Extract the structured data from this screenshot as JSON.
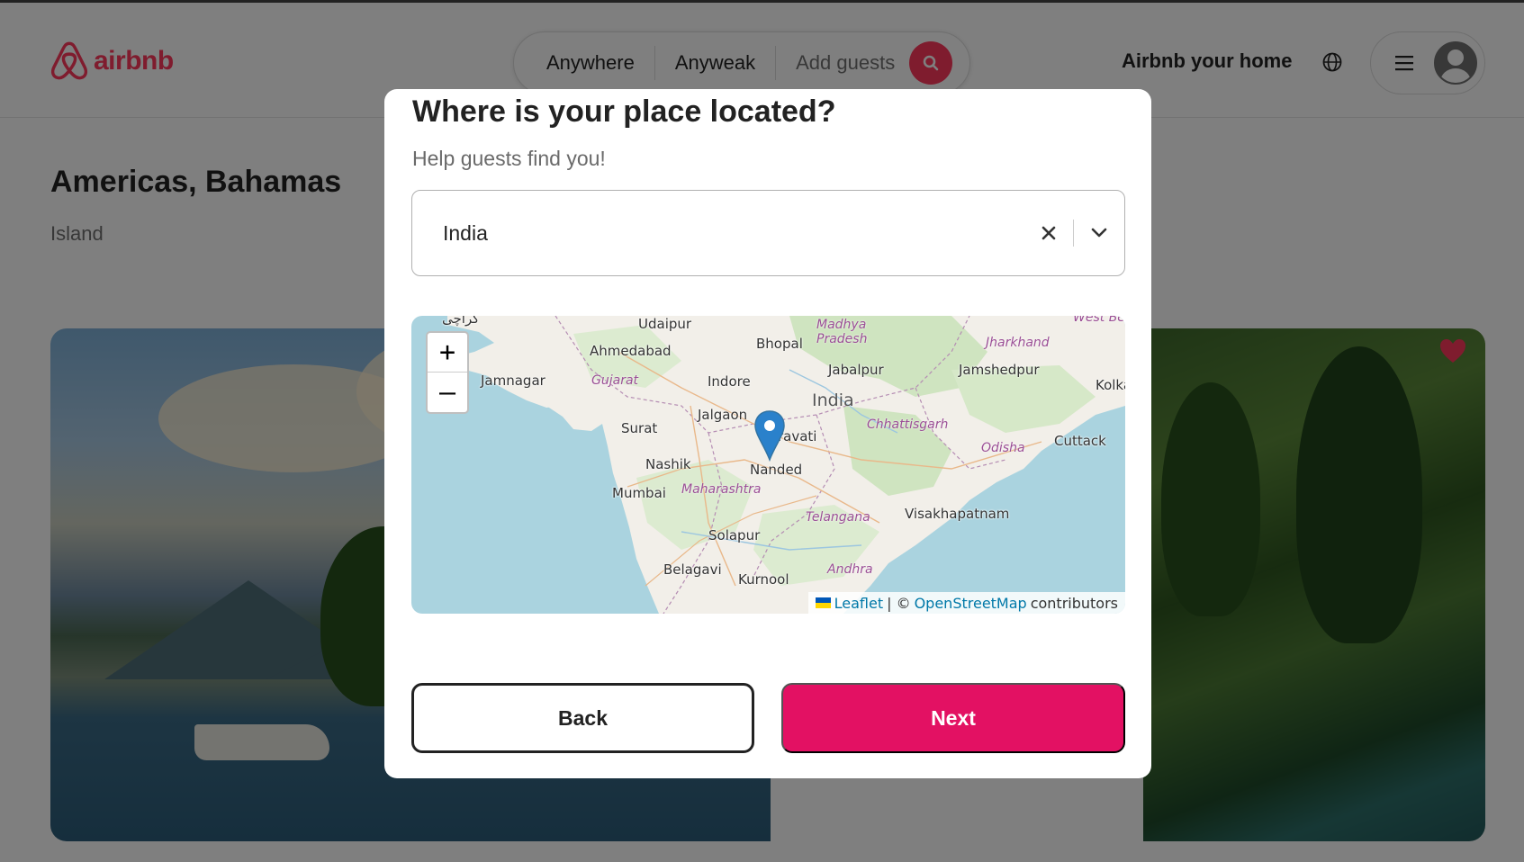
{
  "header": {
    "logo_text": "airbnb",
    "search": {
      "location": "Anywhere",
      "dates": "Anyweak",
      "guests": "Add guests"
    },
    "host_link": "Airbnb your home"
  },
  "listing": {
    "title": "Americas, Bahamas",
    "type": "Island"
  },
  "modal": {
    "title": "Where is your place located?",
    "subtitle": "Help guests find you!",
    "country_select": {
      "value": "India"
    },
    "map": {
      "zoom_in": "+",
      "zoom_out": "–",
      "country_label": "India",
      "cities": [
        "Udaipur",
        "Bhopal",
        "Ahmedabad",
        "Jabalpur",
        "Jamshedpur",
        "Jamnagar",
        "Indore",
        "Kolka",
        "Jalgaon",
        "Surat",
        "Cuttack",
        "ravati",
        "Nashik",
        "Nanded",
        "Mumbai",
        "Visakhapatnam",
        "Solapur",
        "Belagavi",
        "Kurnool"
      ],
      "states": [
        "Madhya",
        "Pradesh",
        "Jharkhand",
        "Gujarat",
        "Chhattisgarh",
        "Odisha",
        "Maharashtra",
        "Telangana",
        "Andhra",
        "West Be"
      ],
      "top_left_label": "کراچی",
      "attribution": {
        "leaflet": "Leaflet",
        "separator": "| ©",
        "osm": "OpenStreetMap",
        "suffix": "contributors"
      }
    },
    "back_label": "Back",
    "next_label": "Next"
  },
  "colors": {
    "brand": "#ff385c",
    "next_button": "#e31163",
    "map_water": "#aad3df",
    "map_land": "#f2efe9",
    "marker": "#2a81cb"
  }
}
